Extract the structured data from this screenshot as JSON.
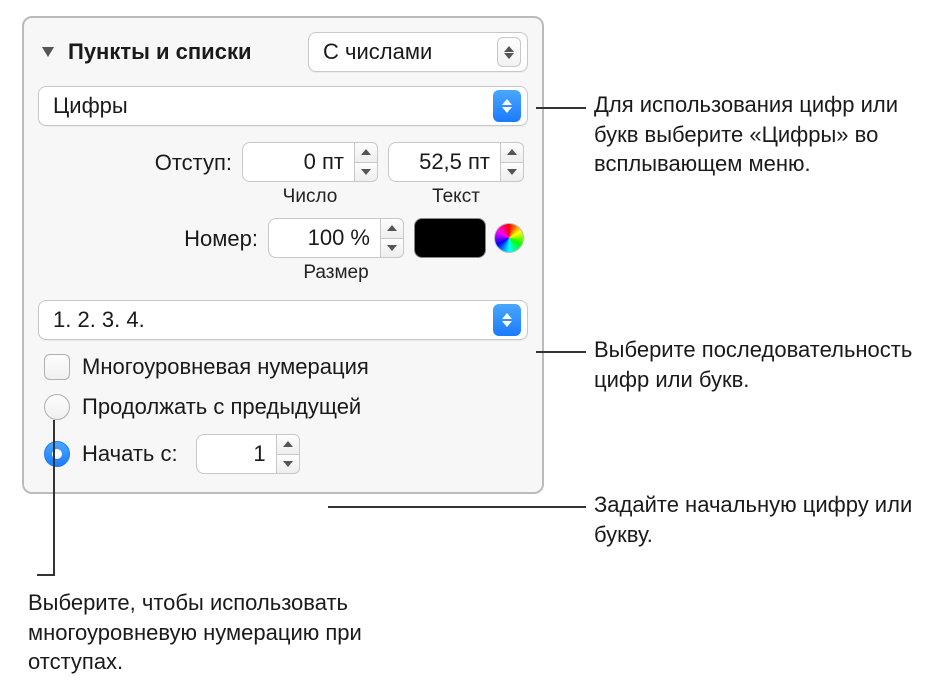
{
  "header": {
    "title": "Пункты и списки",
    "list_type": "С числами"
  },
  "format_popup": "Цифры",
  "indent": {
    "label": "Отступ:",
    "number_value": "0 пт",
    "number_label": "Число",
    "text_value": "52,5 пт",
    "text_label": "Текст"
  },
  "number": {
    "label": "Номер:",
    "size_value": "100 %",
    "size_label": "Размер"
  },
  "sequence_popup": "1. 2. 3. 4.",
  "tiered": {
    "label": "Многоуровневая нумерация"
  },
  "continue": {
    "label": "Продолжать с предыдущей"
  },
  "start": {
    "label": "Начать с:",
    "value": "1"
  },
  "callouts": {
    "format": "Для использования цифр или букв выберите «Цифры» во всплывающем меню.",
    "sequence": "Выберите последовательность цифр или букв.",
    "start": "Задайте начальную цифру или букву.",
    "tiered": "Выберите, чтобы использовать многоуровневую нумерацию при отступах."
  }
}
